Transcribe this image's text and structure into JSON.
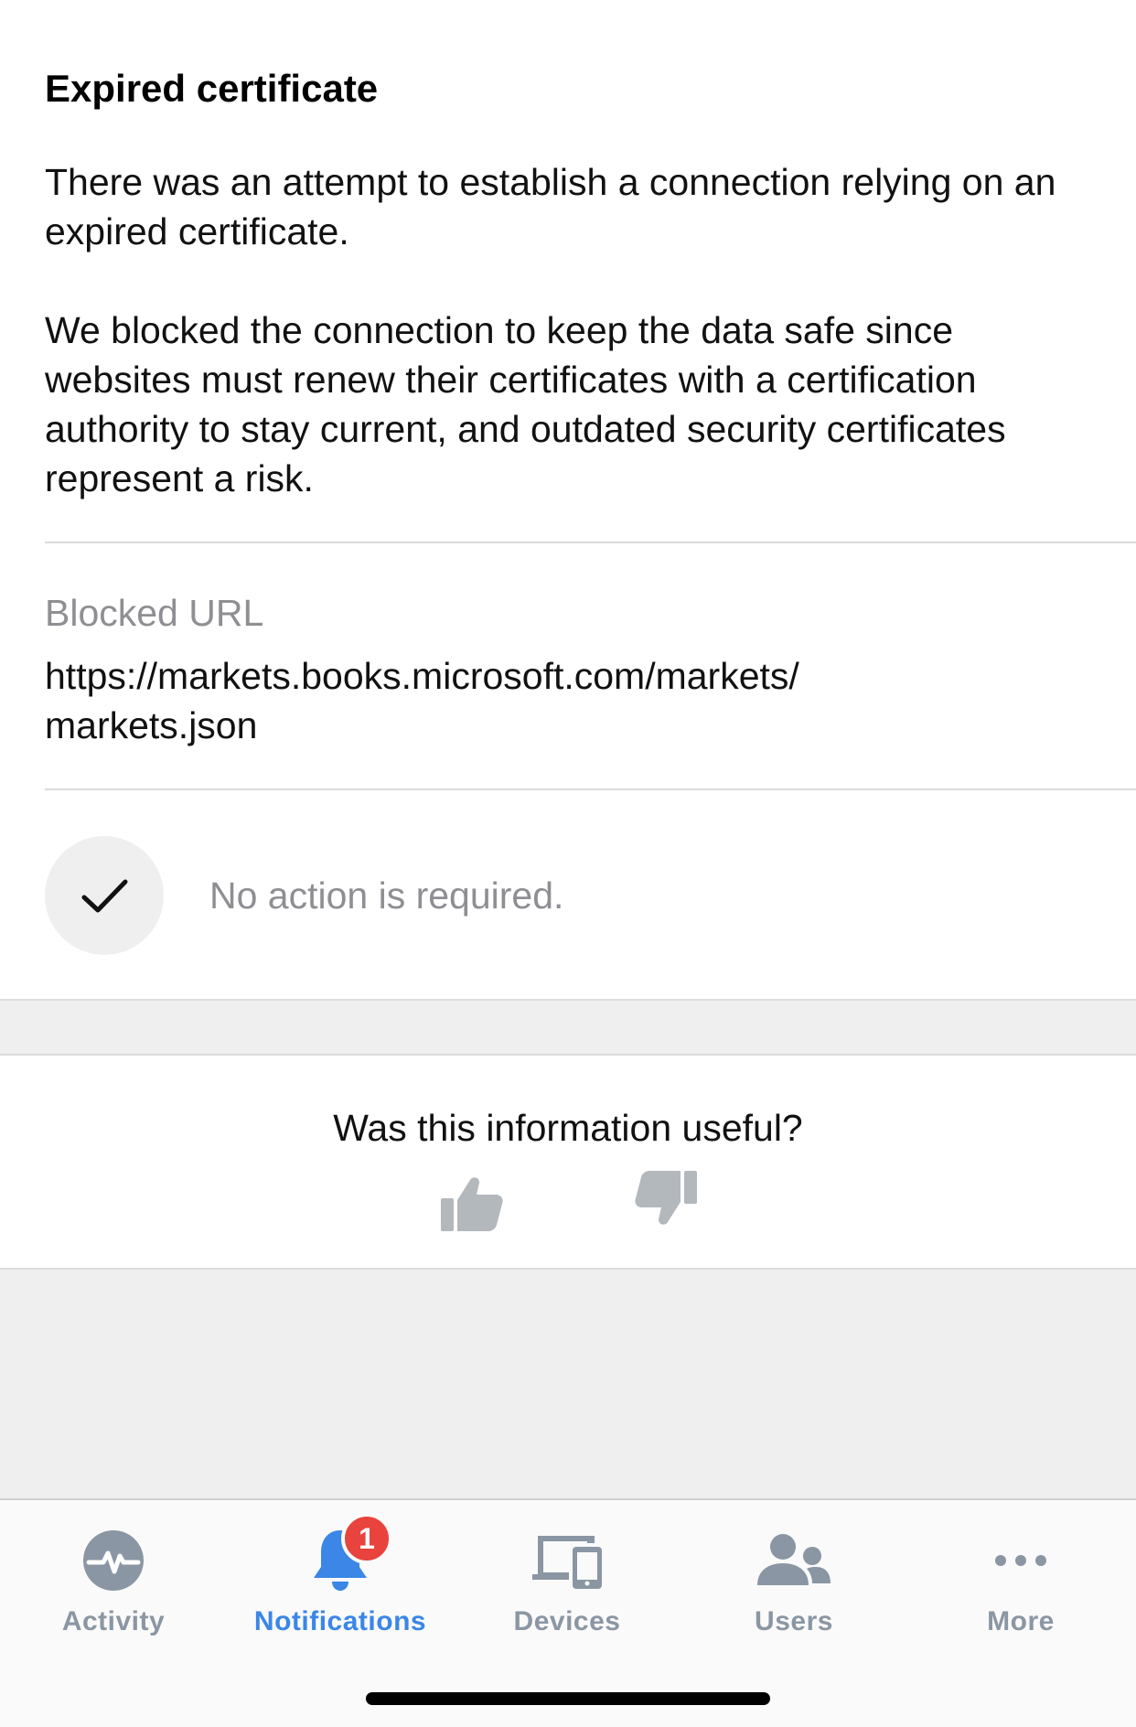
{
  "detail": {
    "title": "Expired certificate",
    "paragraph1": "There was an attempt to establish a connection relying on an expired certificate.",
    "paragraph2": "We blocked the connection to keep the data safe since websites must renew their certificates with a certification authority to stay current, and outdated security certificates represent a risk.",
    "blocked_url_label": "Blocked URL",
    "blocked_url_line1": "https://markets.books.microsoft.com/markets/",
    "blocked_url_line2": "markets.json",
    "action_text": "No action is required.",
    "action_icon": "checkmark-icon"
  },
  "feedback": {
    "question": "Was this information useful?",
    "thumbs_up_icon": "thumbs-up-icon",
    "thumbs_down_icon": "thumbs-down-icon"
  },
  "tabbar": {
    "tabs": [
      {
        "label": "Activity",
        "icon": "activity-icon",
        "active": false
      },
      {
        "label": "Notifications",
        "icon": "bell-icon",
        "active": true,
        "badge": "1"
      },
      {
        "label": "Devices",
        "icon": "devices-icon",
        "active": false
      },
      {
        "label": "Users",
        "icon": "users-icon",
        "active": false
      },
      {
        "label": "More",
        "icon": "more-icon",
        "active": false
      }
    ]
  },
  "colors": {
    "accent": "#3b86e6",
    "inactive": "#8a96a3",
    "badge": "#e8433c",
    "secondary_text": "#8e8e93",
    "background_grey": "#efefef"
  }
}
